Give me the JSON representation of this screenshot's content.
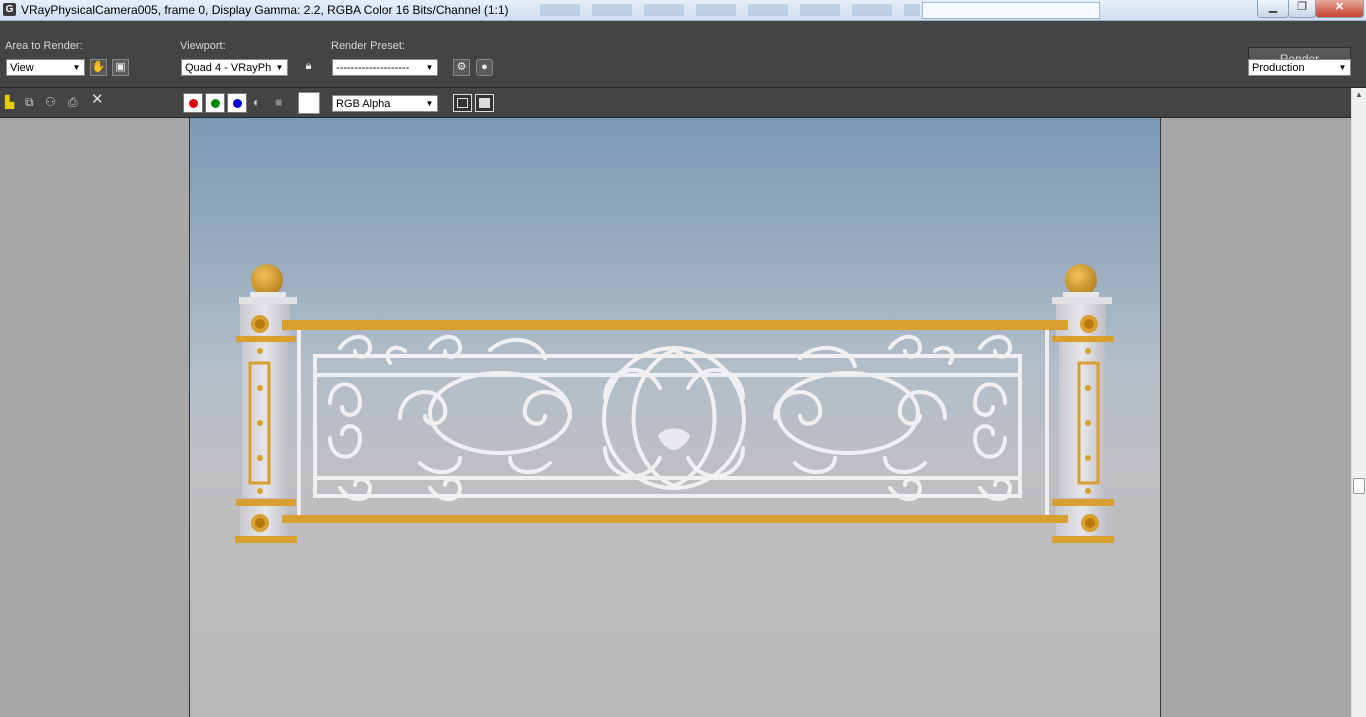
{
  "window": {
    "app_icon": "3ds-max-icon",
    "title": "VRayPhysicalCamera005, frame 0, Display Gamma: 2.2, RGBA Color 16 Bits/Channel (1:1)",
    "buttons": {
      "minimize": "▁",
      "maximize": "❐",
      "close": "✕"
    }
  },
  "toolbar": {
    "area_label": "Area to Render:",
    "area_value": "View",
    "viewport_label": "Viewport:",
    "viewport_value": "Quad 4 - VRayPh",
    "preset_label": "Render Preset:",
    "preset_value": "--------------------",
    "render_button": "Render",
    "production_value": "Production",
    "icons": [
      "edit-region-icon",
      "auto-region-icon",
      "lock-viewport-icon",
      "render-setup-icon",
      "environment-effects-icon"
    ]
  },
  "toolbar2": {
    "icons": [
      "save-image-icon",
      "copy-image-icon",
      "clone-frame-window-icon",
      "print-image-icon",
      "clear-icon"
    ],
    "channels": [
      {
        "name": "red-channel",
        "color": "#e00000"
      },
      {
        "name": "green-channel",
        "color": "#008a00"
      },
      {
        "name": "blue-channel",
        "color": "#0000d0"
      }
    ],
    "alpha_toggle": "◐",
    "mono_toggle": "■",
    "swatch_color": "#ffffff",
    "channel_display": "RGB Alpha"
  },
  "colors": {
    "panel": "#444444",
    "rail_gold": "#d9a030",
    "ironwork": "#f0f0f2"
  }
}
